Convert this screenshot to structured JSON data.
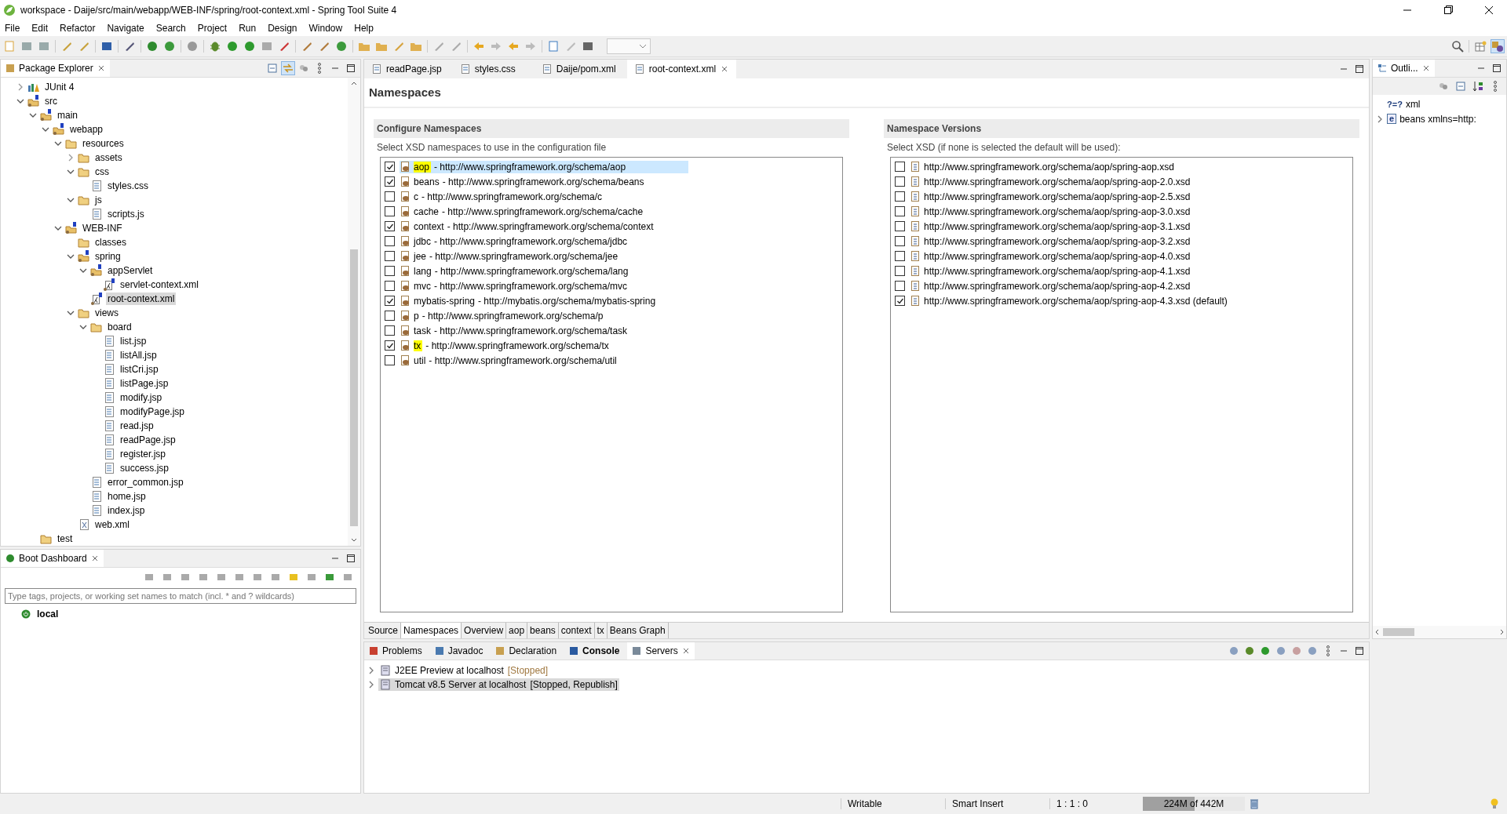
{
  "window": {
    "title": "workspace - Daije/src/main/webapp/WEB-INF/spring/root-context.xml - Spring Tool Suite 4"
  },
  "menu": [
    "File",
    "Edit",
    "Refactor",
    "Navigate",
    "Search",
    "Project",
    "Run",
    "Design",
    "Window",
    "Help"
  ],
  "package_explorer": {
    "title": "Package Explorer",
    "tree": [
      {
        "label": "JUnit 4",
        "kind": "library",
        "expanded": false,
        "selected": false
      },
      {
        "label": "src",
        "kind": "source-folder",
        "expanded": true,
        "selected": false,
        "children": [
          {
            "label": "main",
            "kind": "source-folder",
            "expanded": true,
            "selected": false,
            "children": [
              {
                "label": "webapp",
                "kind": "source-folder",
                "expanded": true,
                "selected": false,
                "children": [
                  {
                    "label": "resources",
                    "kind": "folder",
                    "expanded": true,
                    "selected": false,
                    "children": [
                      {
                        "label": "assets",
                        "kind": "folder",
                        "expanded": false,
                        "selected": false
                      },
                      {
                        "label": "css",
                        "kind": "folder",
                        "expanded": true,
                        "selected": false,
                        "children": [
                          {
                            "label": "styles.css",
                            "kind": "web-file",
                            "selected": false
                          }
                        ]
                      },
                      {
                        "label": "js",
                        "kind": "folder",
                        "expanded": true,
                        "selected": false,
                        "children": [
                          {
                            "label": "scripts.js",
                            "kind": "text-file",
                            "selected": false
                          }
                        ]
                      }
                    ]
                  },
                  {
                    "label": "WEB-INF",
                    "kind": "source-folder",
                    "expanded": true,
                    "selected": false,
                    "children": [
                      {
                        "label": "classes",
                        "kind": "folder",
                        "selected": false
                      },
                      {
                        "label": "spring",
                        "kind": "source-folder",
                        "expanded": true,
                        "selected": false,
                        "children": [
                          {
                            "label": "appServlet",
                            "kind": "source-folder",
                            "expanded": true,
                            "selected": false,
                            "children": [
                              {
                                "label": "servlet-context.xml",
                                "kind": "spring-config",
                                "selected": false
                              }
                            ]
                          },
                          {
                            "label": "root-context.xml",
                            "kind": "spring-config",
                            "selected": true
                          }
                        ]
                      },
                      {
                        "label": "views",
                        "kind": "folder",
                        "expanded": true,
                        "selected": false,
                        "children": [
                          {
                            "label": "board",
                            "kind": "folder",
                            "expanded": true,
                            "selected": false,
                            "children": [
                              {
                                "label": "list.jsp",
                                "kind": "web-file",
                                "selected": false
                              },
                              {
                                "label": "listAll.jsp",
                                "kind": "web-file",
                                "selected": false
                              },
                              {
                                "label": "listCri.jsp",
                                "kind": "web-file",
                                "selected": false
                              },
                              {
                                "label": "listPage.jsp",
                                "kind": "web-file",
                                "selected": false
                              },
                              {
                                "label": "modify.jsp",
                                "kind": "web-file",
                                "selected": false
                              },
                              {
                                "label": "modifyPage.jsp",
                                "kind": "web-file",
                                "selected": false
                              },
                              {
                                "label": "read.jsp",
                                "kind": "web-file",
                                "selected": false
                              },
                              {
                                "label": "readPage.jsp",
                                "kind": "web-file",
                                "selected": false
                              },
                              {
                                "label": "register.jsp",
                                "kind": "web-file",
                                "selected": false
                              },
                              {
                                "label": "success.jsp",
                                "kind": "web-file",
                                "selected": false
                              }
                            ]
                          },
                          {
                            "label": "error_common.jsp",
                            "kind": "web-file",
                            "selected": false
                          },
                          {
                            "label": "home.jsp",
                            "kind": "web-file",
                            "selected": false
                          },
                          {
                            "label": "index.jsp",
                            "kind": "web-file",
                            "selected": false
                          }
                        ]
                      },
                      {
                        "label": "web.xml",
                        "kind": "xml-file",
                        "selected": false
                      }
                    ]
                  }
                ]
              }
            ]
          },
          {
            "label": "test",
            "kind": "folder",
            "selected": false
          }
        ]
      }
    ]
  },
  "boot_dashboard": {
    "title": "Boot Dashboard",
    "filter": {
      "placeholder": "Type tags, projects, or working set names to match (incl. * and ? wildcards)"
    },
    "items": [
      "local"
    ]
  },
  "editor": {
    "tabs": [
      {
        "label": "readPage.jsp",
        "selected": false
      },
      {
        "label": "styles.css",
        "selected": false
      },
      {
        "label": "Daije/pom.xml",
        "selected": false
      },
      {
        "label": "root-context.xml",
        "selected": true
      }
    ],
    "heading": "Namespaces",
    "configure": {
      "title": "Configure Namespaces",
      "hint": "Select XSD namespaces to use in the configuration file",
      "namespaces": [
        {
          "name": "aop",
          "suffix": "- http://www.springframework.org/schema/aop",
          "checked": true,
          "selected": true,
          "highlighted": true
        },
        {
          "name": "beans",
          "suffix": "- http://www.springframework.org/schema/beans",
          "checked": true,
          "selected": false,
          "highlighted": false
        },
        {
          "name": "c",
          "suffix": "- http://www.springframework.org/schema/c",
          "checked": false,
          "selected": false,
          "highlighted": false
        },
        {
          "name": "cache",
          "suffix": "- http://www.springframework.org/schema/cache",
          "checked": false,
          "selected": false,
          "highlighted": false
        },
        {
          "name": "context",
          "suffix": "- http://www.springframework.org/schema/context",
          "checked": true,
          "selected": false,
          "highlighted": false
        },
        {
          "name": "jdbc",
          "suffix": "- http://www.springframework.org/schema/jdbc",
          "checked": false,
          "selected": false,
          "highlighted": false
        },
        {
          "name": "jee",
          "suffix": "- http://www.springframework.org/schema/jee",
          "checked": false,
          "selected": false,
          "highlighted": false
        },
        {
          "name": "lang",
          "suffix": "- http://www.springframework.org/schema/lang",
          "checked": false,
          "selected": false,
          "highlighted": false
        },
        {
          "name": "mvc",
          "suffix": "- http://www.springframework.org/schema/mvc",
          "checked": false,
          "selected": false,
          "highlighted": false
        },
        {
          "name": "mybatis-spring",
          "suffix": "- http://mybatis.org/schema/mybatis-spring",
          "checked": true,
          "selected": false,
          "highlighted": false
        },
        {
          "name": "p",
          "suffix": "- http://www.springframework.org/schema/p",
          "checked": false,
          "selected": false,
          "highlighted": false
        },
        {
          "name": "task",
          "suffix": "- http://www.springframework.org/schema/task",
          "checked": false,
          "selected": false,
          "highlighted": false
        },
        {
          "name": "tx",
          "suffix": "- http://www.springframework.org/schema/tx",
          "checked": true,
          "selected": false,
          "highlighted": true
        },
        {
          "name": "util",
          "suffix": "- http://www.springframework.org/schema/util",
          "checked": false,
          "selected": false,
          "highlighted": false
        }
      ]
    },
    "versions": {
      "title": "Namespace Versions",
      "hint": "Select XSD (if none is selected the default will be used):",
      "items": [
        {
          "label": "http://www.springframework.org/schema/aop/spring-aop.xsd",
          "checked": false
        },
        {
          "label": "http://www.springframework.org/schema/aop/spring-aop-2.0.xsd",
          "checked": false
        },
        {
          "label": "http://www.springframework.org/schema/aop/spring-aop-2.5.xsd",
          "checked": false
        },
        {
          "label": "http://www.springframework.org/schema/aop/spring-aop-3.0.xsd",
          "checked": false
        },
        {
          "label": "http://www.springframework.org/schema/aop/spring-aop-3.1.xsd",
          "checked": false
        },
        {
          "label": "http://www.springframework.org/schema/aop/spring-aop-3.2.xsd",
          "checked": false
        },
        {
          "label": "http://www.springframework.org/schema/aop/spring-aop-4.0.xsd",
          "checked": false
        },
        {
          "label": "http://www.springframework.org/schema/aop/spring-aop-4.1.xsd",
          "checked": false
        },
        {
          "label": "http://www.springframework.org/schema/aop/spring-aop-4.2.xsd",
          "checked": false
        },
        {
          "label": "http://www.springframework.org/schema/aop/spring-aop-4.3.xsd (default)",
          "checked": true
        }
      ]
    },
    "page_tabs": [
      {
        "label": "Source",
        "selected": false
      },
      {
        "label": "Namespaces",
        "selected": true
      },
      {
        "label": "Overview",
        "selected": false
      },
      {
        "label": "aop",
        "selected": false
      },
      {
        "label": "beans",
        "selected": false
      },
      {
        "label": "context",
        "selected": false
      },
      {
        "label": "tx",
        "selected": false
      },
      {
        "label": "Beans Graph",
        "selected": false
      }
    ]
  },
  "outline": {
    "title": "Outli...",
    "items": [
      {
        "icon_text": "?=?",
        "label": "xml"
      },
      {
        "icon_text": "e",
        "label": "beans xmlns=http:",
        "expanded": false
      }
    ]
  },
  "bottom_panel": {
    "tabs": [
      {
        "label": "Problems",
        "selected": false,
        "changed": false
      },
      {
        "label": "Javadoc",
        "selected": false,
        "changed": false
      },
      {
        "label": "Declaration",
        "selected": false,
        "changed": false
      },
      {
        "label": "Console",
        "selected": false,
        "changed": true
      },
      {
        "label": "Servers",
        "selected": true,
        "changed": false
      }
    ],
    "servers": [
      {
        "name": "J2EE Preview at localhost",
        "status": "[Stopped]",
        "expanded": false,
        "selected": false
      },
      {
        "name": "Tomcat v8.5 Server at localhost",
        "status": "[Stopped, Republish]",
        "expanded": false,
        "selected": true
      }
    ]
  },
  "status_bar": {
    "mode": "Writable",
    "insert": "Smart Insert",
    "position": "1 : 1 : 0",
    "memory": {
      "text": "224M of 442M",
      "level": 0.51
    }
  }
}
